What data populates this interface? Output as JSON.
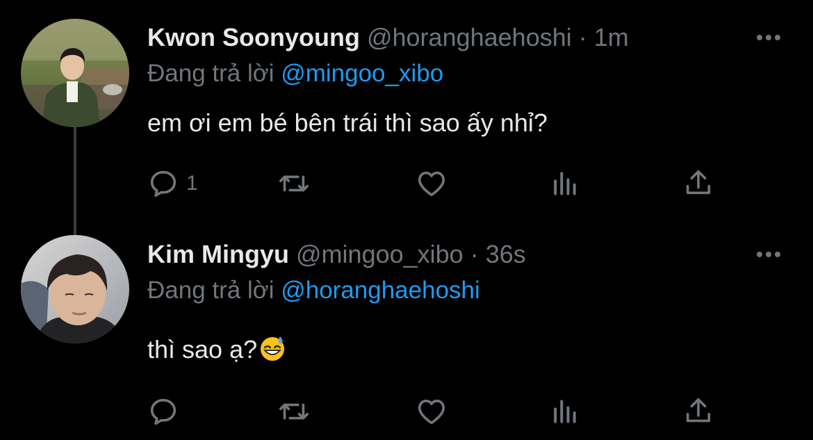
{
  "tweets": [
    {
      "name": "Kwon Soonyoung",
      "handle": "@horanghaehoshi",
      "separator": "·",
      "time": "1m",
      "reply_prefix": "Đang trả lời",
      "reply_to": "@mingoo_xibo",
      "text": "em ơi em bé bên trái thì sao ấy nhỉ?",
      "reply_count": "1"
    },
    {
      "name": "Kim Mingyu",
      "handle": "@mingoo_xibo",
      "separator": "·",
      "time": "36s",
      "reply_prefix": "Đang trả lời",
      "reply_to": "@horanghaehoshi",
      "text": "thì sao ạ?",
      "emoji": "grinning-face-with-sweat",
      "reply_count": ""
    }
  ],
  "colors": {
    "background": "#000000",
    "primary_text": "#e7e9ea",
    "secondary_text": "#71767b",
    "link": "#1d9bf0",
    "thread_line": "#3a3c3f"
  },
  "icons": [
    "reply-icon",
    "retweet-icon",
    "like-icon",
    "views-icon",
    "share-icon",
    "more-icon"
  ]
}
